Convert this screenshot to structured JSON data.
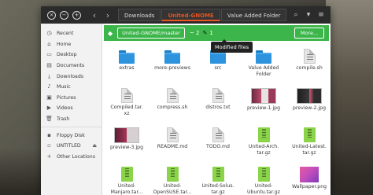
{
  "titlebar": {
    "breadcrumbs": [
      "Downloads",
      "United-GNOME",
      "Value Added Folder"
    ]
  },
  "sidebar": {
    "items": [
      {
        "label": "Recent",
        "icon": "clock-icon"
      },
      {
        "label": "Home",
        "icon": "home-icon"
      },
      {
        "label": "Desktop",
        "icon": "desktop-icon"
      },
      {
        "label": "Documents",
        "icon": "documents-icon"
      },
      {
        "label": "Downloads",
        "icon": "download-icon"
      },
      {
        "label": "Music",
        "icon": "music-icon"
      },
      {
        "label": "Pictures",
        "icon": "pictures-icon"
      },
      {
        "label": "Videos",
        "icon": "videos-icon"
      },
      {
        "label": "Trash",
        "icon": "trash-icon"
      }
    ],
    "devices": [
      {
        "label": "Floppy Disk",
        "icon": "floppy-icon"
      },
      {
        "label": "UNTITLED",
        "icon": "drive-icon"
      },
      {
        "label": "Other Locations",
        "icon": "plus-icon"
      }
    ]
  },
  "gitbar": {
    "branch": "United-GNOME/master",
    "status": "~ 2",
    "count": "1",
    "more_label": "More...",
    "tooltip": "Modified files"
  },
  "files": [
    {
      "name": "extras",
      "type": "folder"
    },
    {
      "name": "more-previews",
      "type": "folder"
    },
    {
      "name": "src",
      "type": "folder"
    },
    {
      "name": "Value Added\nFolder",
      "type": "folder"
    },
    {
      "name": "compile.sh",
      "type": "doc"
    },
    {
      "name": "Compiled.tar.\nxz",
      "type": "doc"
    },
    {
      "name": "compress.sh",
      "type": "doc"
    },
    {
      "name": "distros.txt",
      "type": "doc"
    },
    {
      "name": "preview-1.jpg",
      "type": "image",
      "thumb": "t1"
    },
    {
      "name": "preview-2.jpg",
      "type": "image",
      "thumb": "t2"
    },
    {
      "name": "preview-3.jpg",
      "type": "image",
      "thumb": "t3"
    },
    {
      "name": "README.md",
      "type": "doc"
    },
    {
      "name": "TODO.md",
      "type": "doc"
    },
    {
      "name": "United-Arch.\ntar.gz",
      "type": "archive"
    },
    {
      "name": "United-Latest.\ntar.gz",
      "type": "archive"
    },
    {
      "name": "United-\nManjaro.tar...",
      "type": "archive"
    },
    {
      "name": "United-\nOpenSUSE.tar...",
      "type": "archive"
    },
    {
      "name": "United-Solus.\ntar.gz",
      "type": "archive"
    },
    {
      "name": "United-\nUbuntu.tar.gz",
      "type": "archive"
    },
    {
      "name": "Wallpaper.png",
      "type": "image",
      "thumb": "wall"
    }
  ]
}
